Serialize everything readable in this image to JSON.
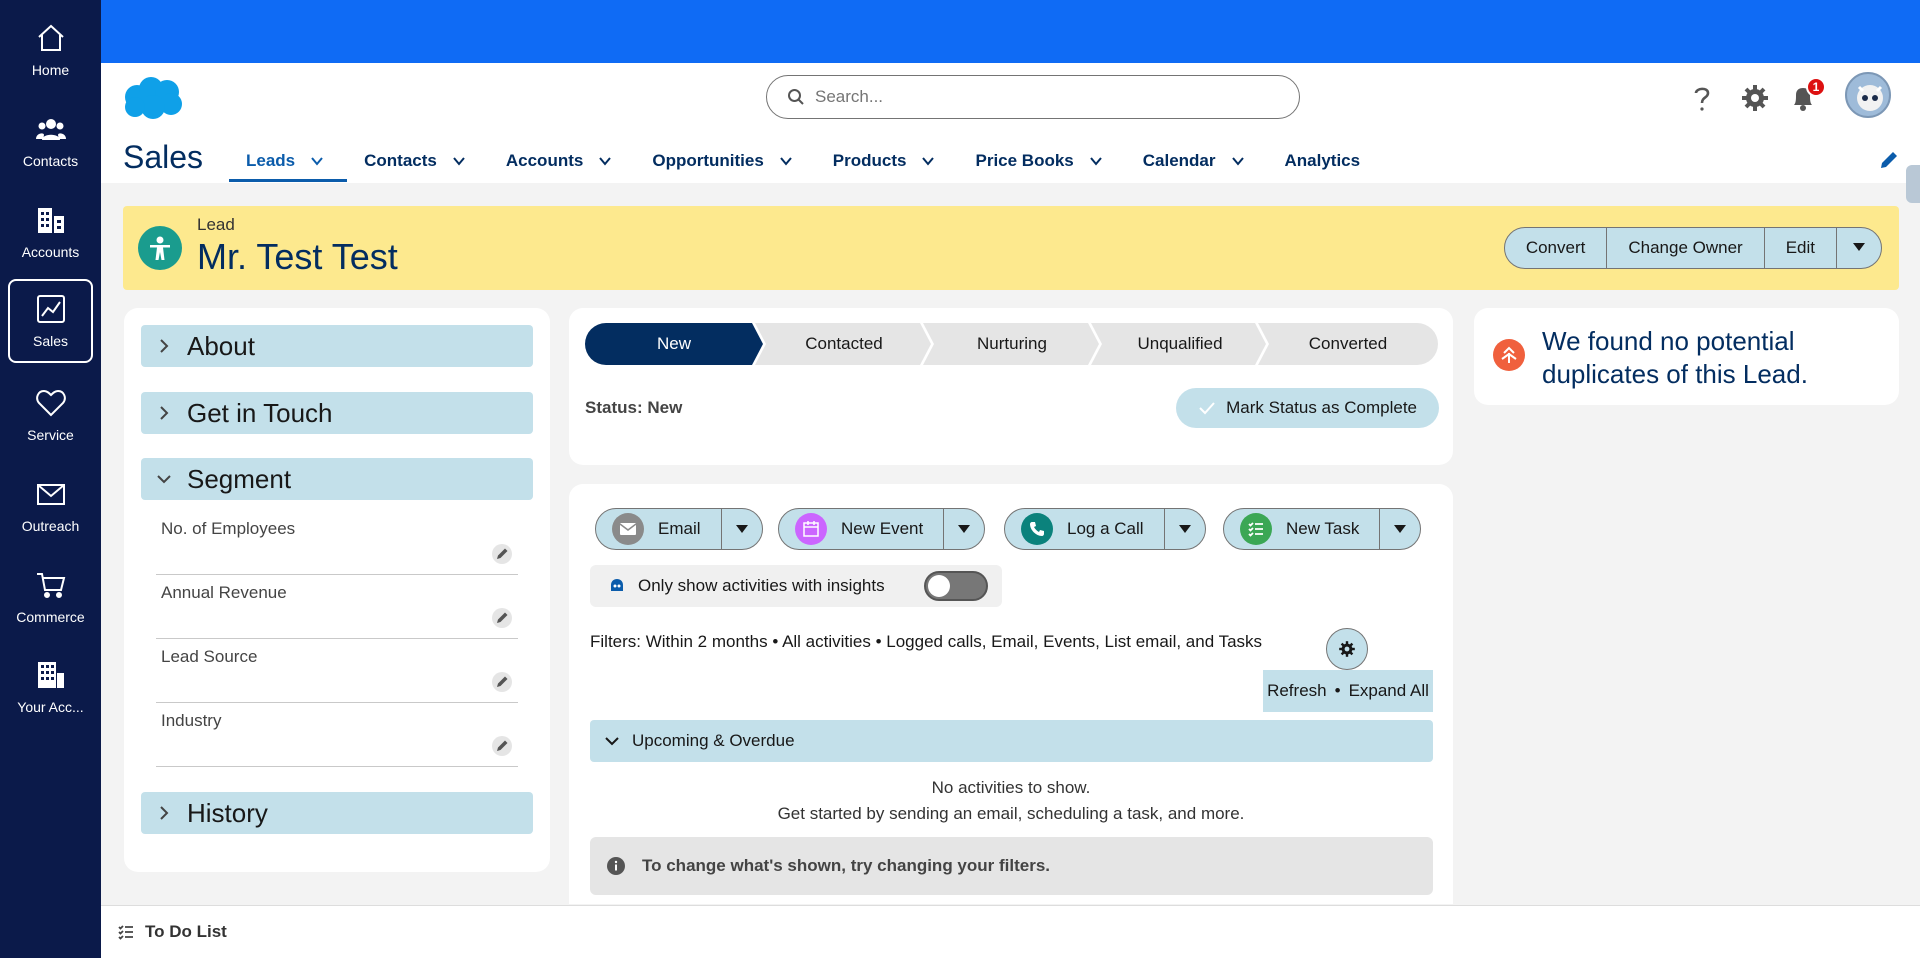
{
  "rail": {
    "items": [
      {
        "label": "Home",
        "icon": "home-icon"
      },
      {
        "label": "Contacts",
        "icon": "people-icon"
      },
      {
        "label": "Accounts",
        "icon": "building-icon"
      },
      {
        "label": "Sales",
        "icon": "chart-icon"
      },
      {
        "label": "Service",
        "icon": "heart-icon"
      },
      {
        "label": "Outreach",
        "icon": "mail-icon"
      },
      {
        "label": "Commerce",
        "icon": "cart-icon"
      },
      {
        "label": "Your Acc...",
        "icon": "building-grid-icon"
      }
    ],
    "active": "Sales"
  },
  "header": {
    "search_placeholder": "Search...",
    "notifications_count": "1",
    "app_name": "Sales"
  },
  "nav": {
    "items": [
      {
        "label": "Leads",
        "has_menu": true
      },
      {
        "label": "Contacts",
        "has_menu": true
      },
      {
        "label": "Accounts",
        "has_menu": true
      },
      {
        "label": "Opportunities",
        "has_menu": true
      },
      {
        "label": "Products",
        "has_menu": true
      },
      {
        "label": "Price Books",
        "has_menu": true
      },
      {
        "label": "Calendar",
        "has_menu": true
      },
      {
        "label": "Analytics",
        "has_menu": false
      }
    ],
    "active": "Leads"
  },
  "record": {
    "type": "Lead",
    "name": "Mr. Test Test",
    "actions": [
      "Convert",
      "Change Owner",
      "Edit"
    ]
  },
  "details": {
    "sections": {
      "about": "About",
      "get_in_touch": "Get in Touch",
      "segment": "Segment",
      "history": "History"
    },
    "fields": [
      "No. of Employees",
      "Annual Revenue",
      "Lead Source",
      "Industry"
    ]
  },
  "path": {
    "stages": [
      "New",
      "Contacted",
      "Nurturing",
      "Unqualified",
      "Converted"
    ],
    "current": "New",
    "status_text": "Status: New",
    "mark_complete": "Mark Status as Complete"
  },
  "activity": {
    "buttons": [
      {
        "label": "Email",
        "color": "#8a8a8a"
      },
      {
        "label": "New Event",
        "color": "#cb65ff"
      },
      {
        "label": "Log a Call",
        "color": "#0b827c"
      },
      {
        "label": "New Task",
        "color": "#3ba755"
      }
    ],
    "insights_label": "Only show activities with insights",
    "filters": "Filters: Within 2 months • All activities • Logged calls, Email, Events, List email, and Tasks",
    "refresh": "Refresh",
    "separator": "•",
    "expand_all": "Expand All",
    "upcoming": "Upcoming & Overdue",
    "empty_title": "No activities to show.",
    "empty_sub": "Get started by sending an email, scheduling a task, and more.",
    "hint": "To change what's shown, try changing your filters."
  },
  "duplicates": {
    "text": "We found no potential duplicates of this Lead."
  },
  "utility": {
    "todo": "To Do List"
  },
  "colors": {
    "rail": "#0b1a4a",
    "topbar": "#0f6bf5",
    "record_header": "#fde98e",
    "accent_light": "#c3e0ea",
    "path_active": "#032d60"
  }
}
